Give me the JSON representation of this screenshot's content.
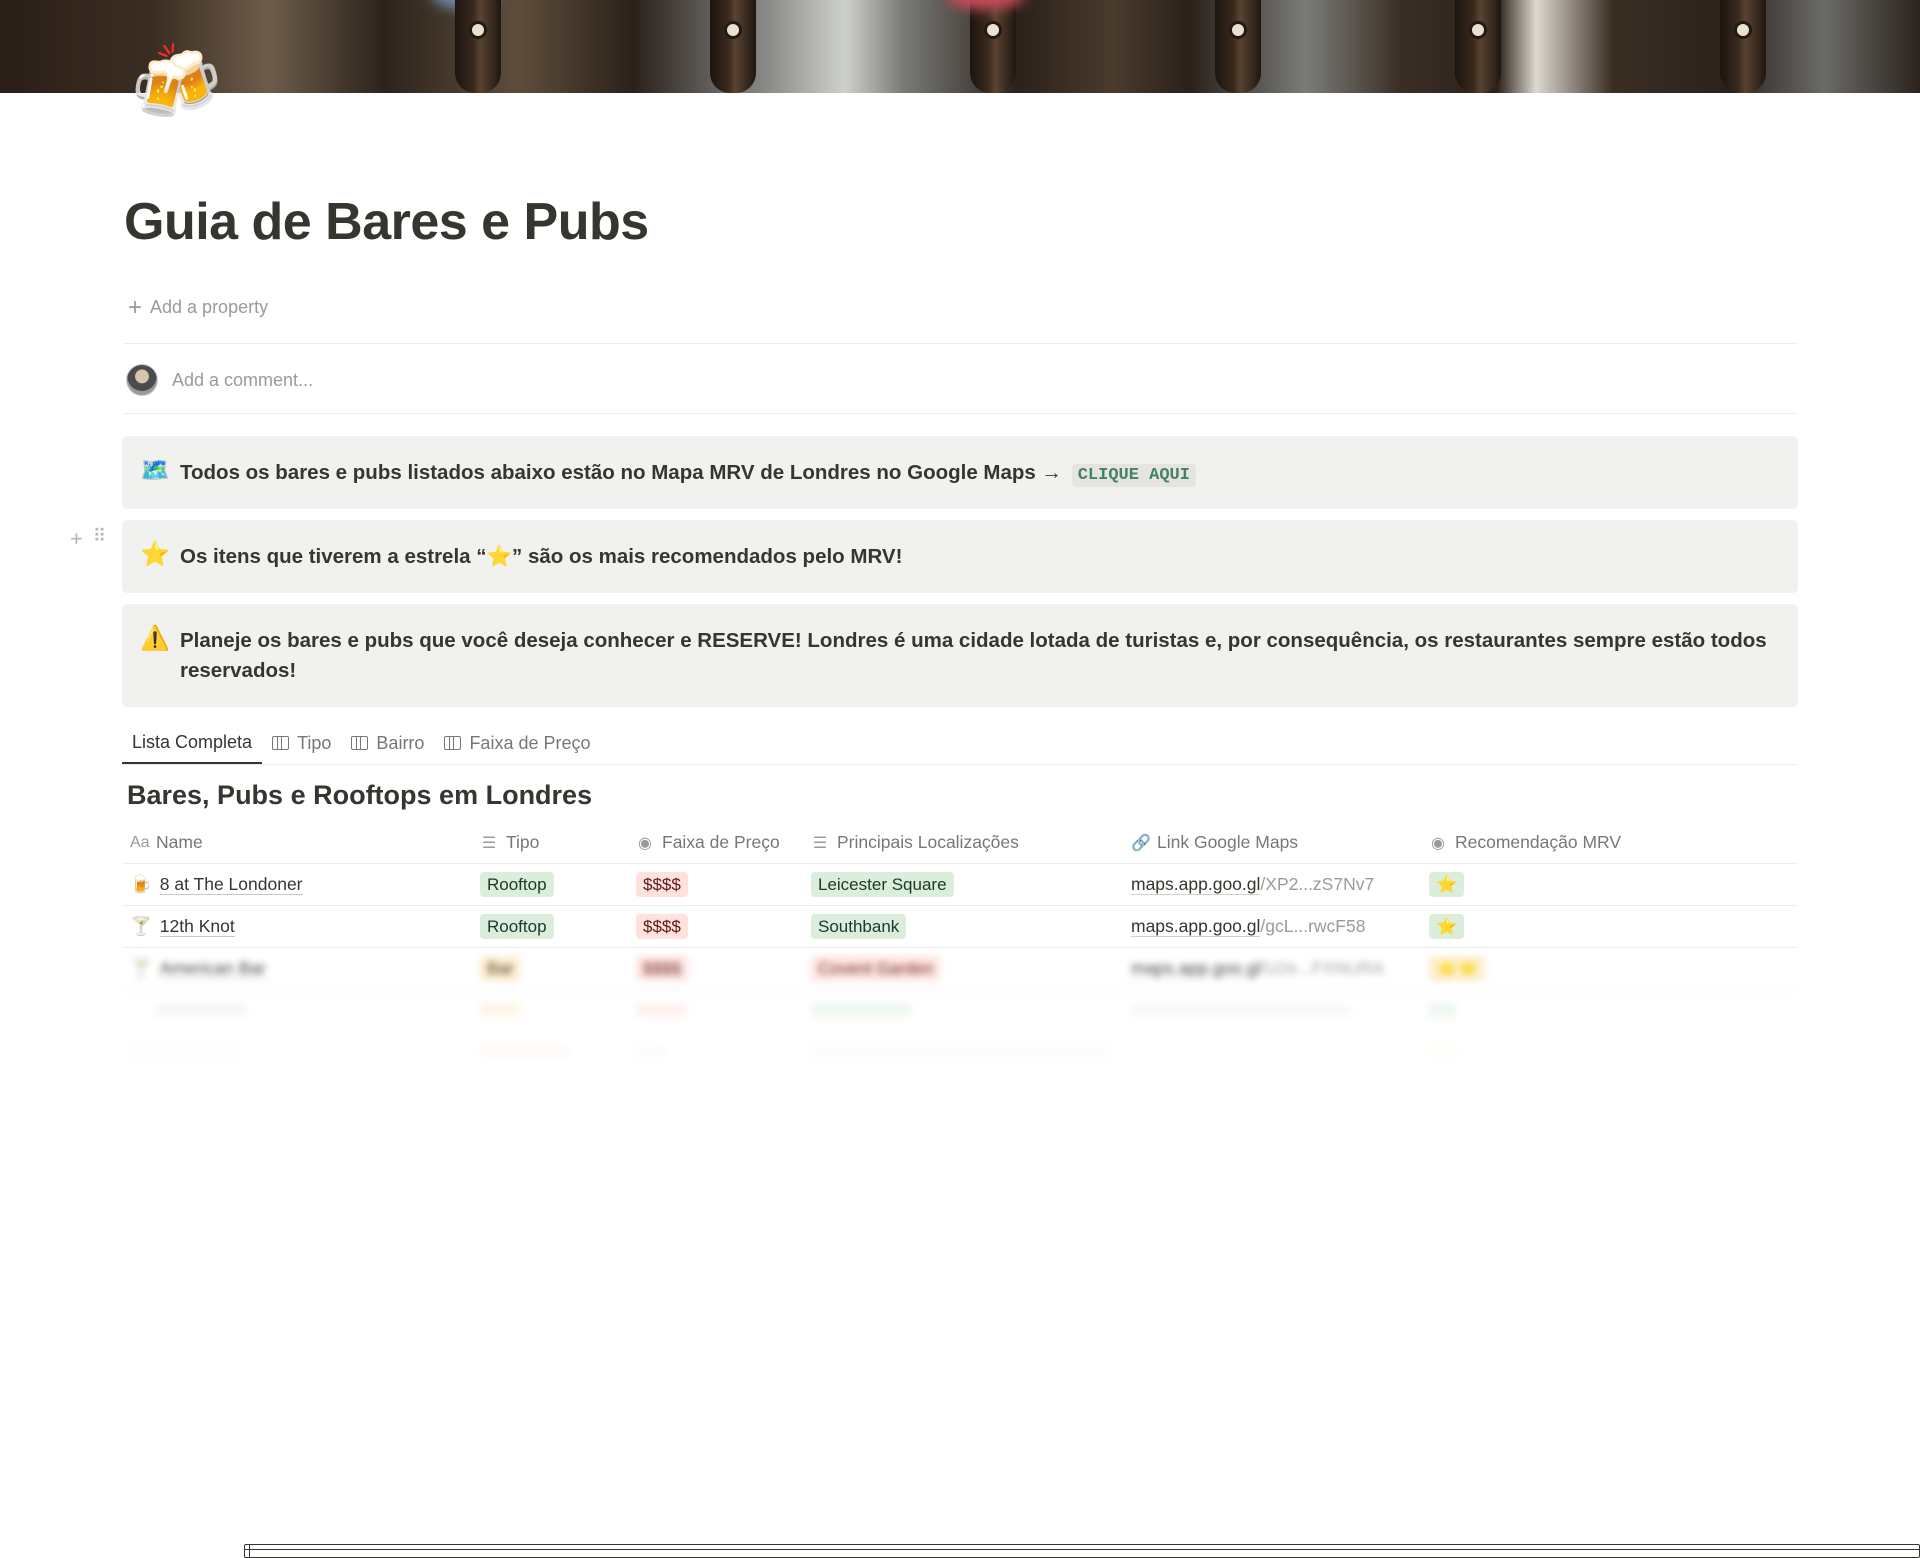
{
  "page": {
    "icon": "🍻",
    "title": "Guia de Bares e Pubs",
    "add_property": "Add a property",
    "comment_placeholder": "Add a comment..."
  },
  "callouts": [
    {
      "icon": "🗺️",
      "text": "Todos os bares e pubs listados abaixo estão no Mapa MRV de Londres no Google Maps →",
      "button": "CLIQUE AQUI"
    },
    {
      "icon": "⭐",
      "text": "Os itens que tiverem a estrela “⭐” são os mais recomendados pelo MRV!"
    },
    {
      "icon": "⚠️",
      "text": "Planeje os bares e pubs que você deseja conhecer e RESERVE! Londres é uma cidade lotada de turistas e, por consequência, os restaurantes sempre estão todos reservados!"
    }
  ],
  "tabs": [
    {
      "label": "Lista Completa",
      "icon": "table-icon",
      "active": true
    },
    {
      "label": "Tipo",
      "icon": "board-icon"
    },
    {
      "label": "Bairro",
      "icon": "board-icon"
    },
    {
      "label": "Faixa de Preço",
      "icon": "board-icon"
    }
  ],
  "database": {
    "title": "Bares, Pubs e Rooftops em Londres",
    "columns": [
      {
        "label": "Name",
        "icon": "Aa"
      },
      {
        "label": "Tipo",
        "icon": "☰"
      },
      {
        "label": "Faixa de Preço",
        "icon": "◉"
      },
      {
        "label": "Principais Localizações",
        "icon": "☰"
      },
      {
        "label": "Link Google Maps",
        "icon": "🔗"
      },
      {
        "label": "Recomendação MRV",
        "icon": "◉"
      }
    ],
    "rows": [
      {
        "icon": "🍺",
        "name": "8 at The Londoner",
        "tipo": "Rooftop",
        "preco": "$$$$",
        "local": "Leicester Square",
        "link_host": "maps.app.goo.gl",
        "link_path": "/XP2...zS7Nv7",
        "rec": "⭐"
      },
      {
        "icon": "🍸",
        "name": "12th Knot",
        "tipo": "Rooftop",
        "preco": "$$$$",
        "local": "Southbank",
        "link_host": "maps.app.goo.gl",
        "link_path": "/gcL...rwcF58",
        "rec": "⭐"
      },
      {
        "icon": "🍸",
        "name": "American Bar",
        "tipo": "Bar",
        "preco": "$$$$",
        "local": "Covent Garden",
        "link_host": "maps.app.goo.gl",
        "link_path": "/U2e...FXNURA",
        "rec": "⭐⭐"
      }
    ]
  },
  "colors": {
    "text": "#37352f",
    "muted": "#9b9a97",
    "callout_bg": "#f1f1ef",
    "tag_green": "#dbeddb",
    "tag_red": "#ffe2dd",
    "tag_yellow": "#fdecc8"
  }
}
